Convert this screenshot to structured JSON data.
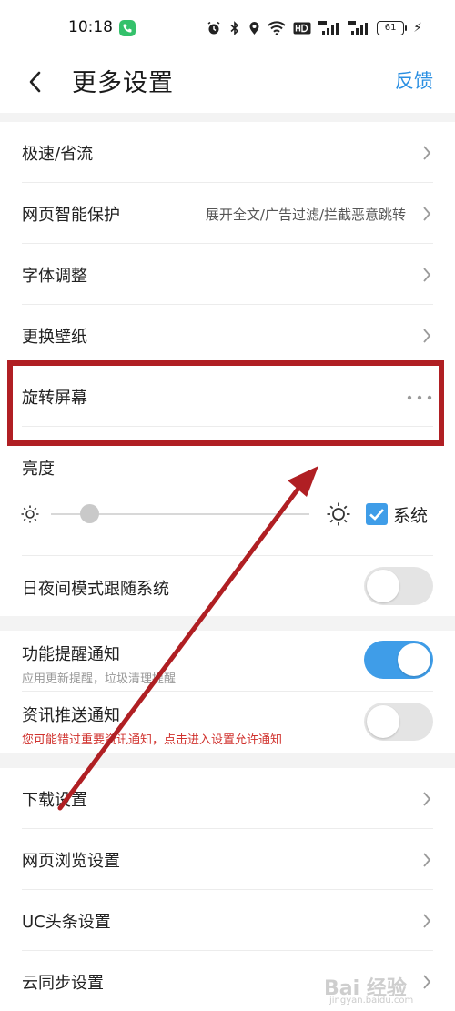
{
  "status_bar": {
    "time": "10:18",
    "battery": "61"
  },
  "header": {
    "title": "更多设置",
    "feedback": "反馈"
  },
  "section1": [
    {
      "label": "极速/省流",
      "value": ""
    },
    {
      "label": "网页智能保护",
      "value": "展开全文/广告过滤/拦截恶意跳转"
    },
    {
      "label": "字体调整",
      "value": ""
    },
    {
      "label": "更换壁纸",
      "value": ""
    },
    {
      "label": "旋转屏幕",
      "value": ""
    }
  ],
  "brightness": {
    "title": "亮度",
    "system_label": "系统",
    "system_checked": true,
    "level": 0.15
  },
  "night_mode": {
    "label": "日夜间模式跟随系统",
    "on": false
  },
  "notifications": {
    "feature": {
      "label": "功能提醒通知",
      "sub": "应用更新提醒，垃圾清理提醒",
      "on": true
    },
    "news": {
      "label": "资讯推送通知",
      "sub": "您可能错过重要资讯通知，点击进入设置允许通知",
      "on": false
    }
  },
  "section3": [
    {
      "label": "下载设置"
    },
    {
      "label": "网页浏览设置"
    },
    {
      "label": "UC头条设置"
    },
    {
      "label": "云同步设置"
    }
  ],
  "colors": {
    "accent": "#3f9de8",
    "highlight": "#b01f23",
    "warning_text": "#d0312d",
    "sub_text": "#999999"
  },
  "watermark": {
    "brand": "Bai 经验",
    "url": "jingyan.baidu.com"
  }
}
